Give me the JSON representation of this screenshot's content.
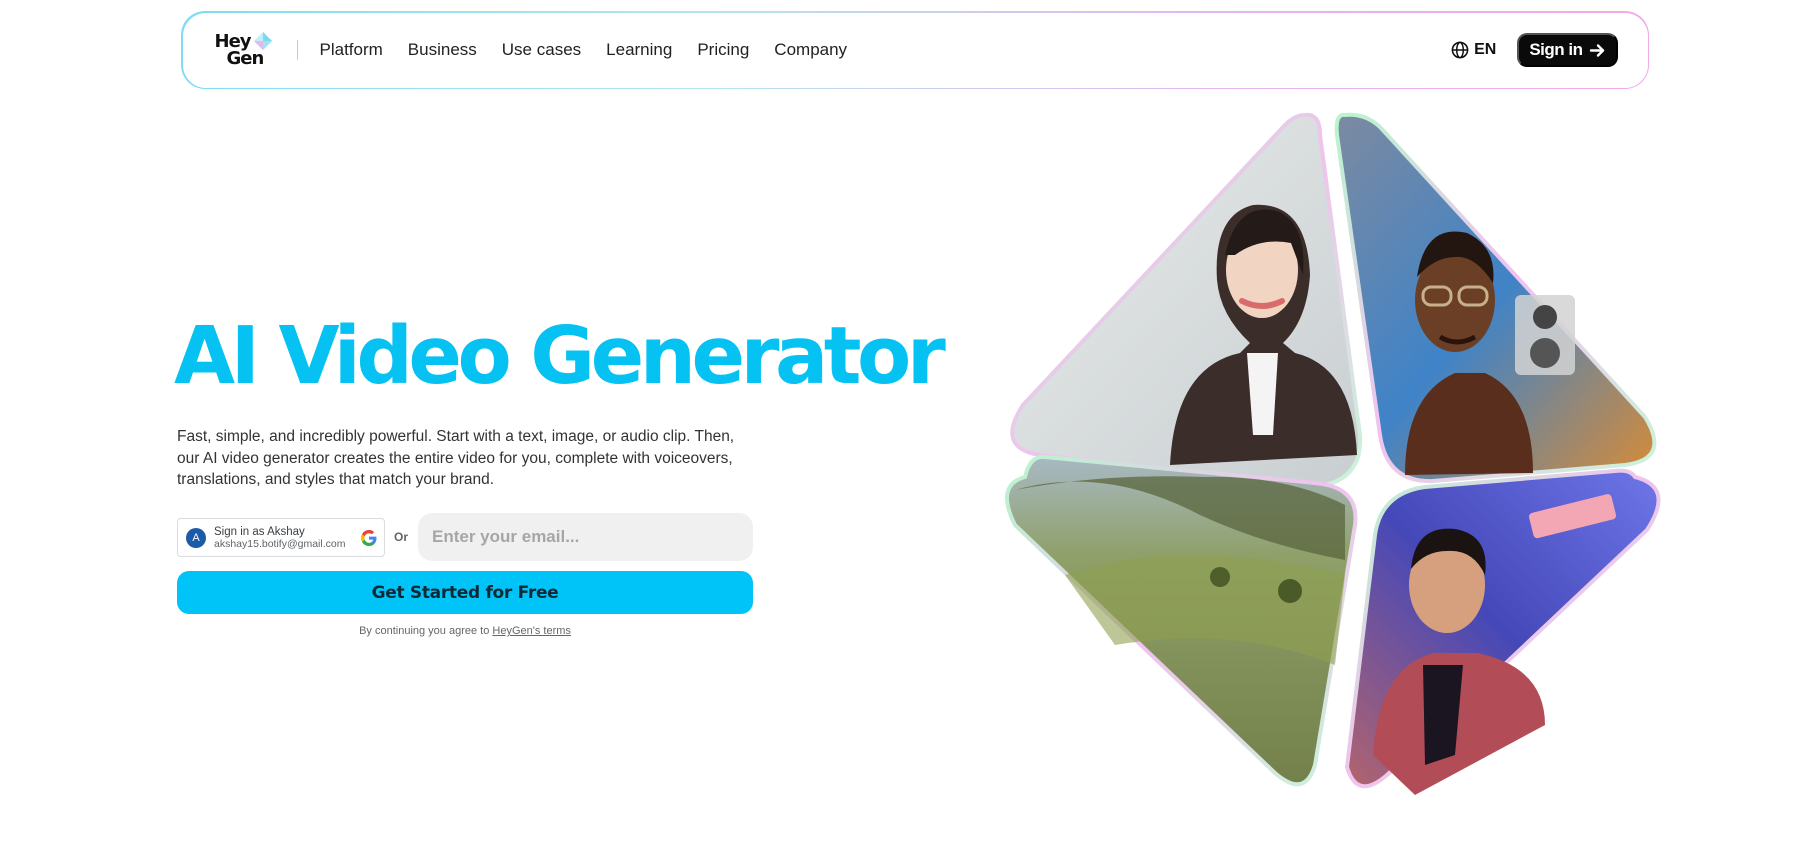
{
  "nav": {
    "logo_line1": "Hey",
    "logo_line2": "Gen",
    "items": [
      "Platform",
      "Business",
      "Use cases",
      "Learning",
      "Pricing",
      "Company"
    ],
    "language": "EN",
    "signin_label": "Sign in"
  },
  "hero": {
    "title": "AI Video Generator",
    "description": "Fast, simple, and incredibly powerful. Start with a text, image, or audio clip. Then, our AI video generator creates the entire video for you, complete with voiceovers, translations, and styles that match your brand."
  },
  "google_signin": {
    "avatar_letter": "A",
    "name": "Sign in as Akshay",
    "email": "akshay15.botify@gmail.com"
  },
  "or_label": "Or",
  "email_input": {
    "placeholder": "Enter your email...",
    "value": ""
  },
  "cta_label": "Get Started for Free",
  "terms": {
    "prefix": "By continuing you agree to",
    "link": "HeyGen's terms"
  },
  "colors": {
    "accent": "#06c2f3",
    "cta_bg": "#00c3f8",
    "signin_bg": "#0a0a0a"
  },
  "icons": [
    "globe-icon",
    "arrow-right-icon",
    "google-g-icon",
    "heygen-gem-icon"
  ]
}
